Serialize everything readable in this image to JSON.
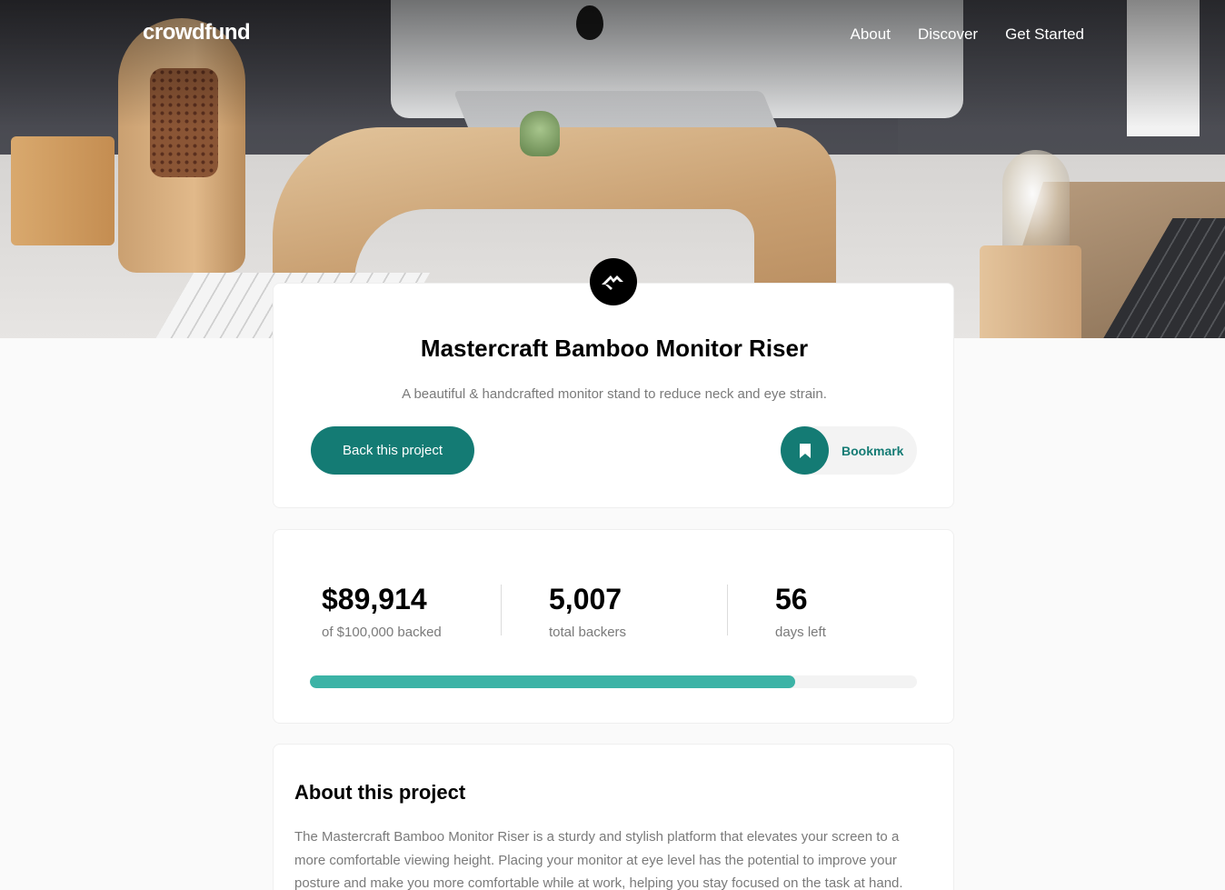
{
  "header": {
    "logo": "crowdfund",
    "nav": [
      "About",
      "Discover",
      "Get Started"
    ]
  },
  "project": {
    "title": "Mastercraft Bamboo Monitor Riser",
    "description": "A beautiful & handcrafted monitor stand to reduce neck and eye strain.",
    "back_label": "Back this project",
    "bookmark_label": "Bookmark"
  },
  "stats": {
    "backed_value": "$89,914",
    "backed_label": "of $100,000 backed",
    "backers_value": "5,007",
    "backers_label": "total backers",
    "days_value": "56",
    "days_label": "days left",
    "progress_fraction": 0.8
  },
  "about": {
    "title": "About this project",
    "text": "The Mastercraft Bamboo Monitor Riser is a sturdy and stylish platform that elevates your screen to a more comfortable viewing height. Placing your monitor at eye level has the potential to improve your posture and make you more comfortable while at work, helping you stay focused on the task at hand."
  },
  "colors": {
    "accent": "#147b74",
    "progress": "#3cb3a6",
    "muted_text": "#7a7a7a"
  },
  "icons": [
    "mastercraft-logo-icon",
    "bookmark-icon"
  ]
}
